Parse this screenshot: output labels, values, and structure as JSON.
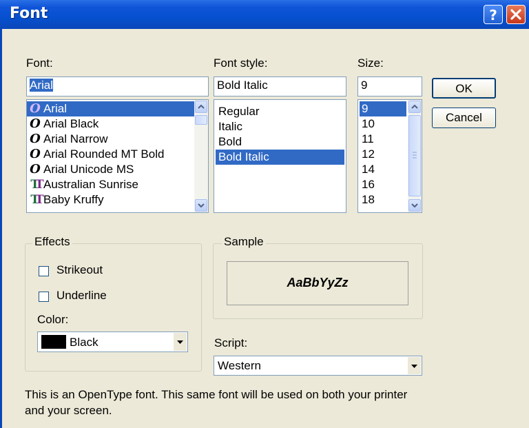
{
  "window": {
    "title": "Font"
  },
  "caption_buttons": {
    "help": "?",
    "close": "×"
  },
  "font": {
    "label": "Font:",
    "value": "Arial",
    "items": [
      {
        "label": "Arial",
        "icon": "opentype-icon",
        "selected": true
      },
      {
        "label": "Arial Black",
        "icon": "opentype-icon"
      },
      {
        "label": "Arial Narrow",
        "icon": "opentype-icon"
      },
      {
        "label": "Arial Rounded MT Bold",
        "icon": "opentype-icon"
      },
      {
        "label": "Arial Unicode MS",
        "icon": "opentype-icon"
      },
      {
        "label": "Australian Sunrise",
        "icon": "truetype-icon"
      },
      {
        "label": "Baby Kruffy",
        "icon": "truetype-icon"
      }
    ]
  },
  "style": {
    "label": "Font style:",
    "value": "Bold Italic",
    "items": [
      "Regular",
      "Italic",
      "Bold",
      "Bold Italic"
    ],
    "selected_index": 3
  },
  "size": {
    "label": "Size:",
    "value": "9",
    "items": [
      "9",
      "10",
      "11",
      "12",
      "14",
      "16",
      "18"
    ],
    "selected_index": 0
  },
  "buttons": {
    "ok": "OK",
    "cancel": "Cancel"
  },
  "effects": {
    "title": "Effects",
    "strikeout": "Strikeout",
    "underline": "Underline",
    "strikeout_checked": false,
    "underline_checked": false,
    "color_label": "Color:",
    "color_value": "Black",
    "color_swatch": "#000000"
  },
  "sample": {
    "title": "Sample",
    "text": "AaBbYyZz"
  },
  "script": {
    "label": "Script:",
    "value": "Western"
  },
  "info": "This is an OpenType font. This same font will be used on both your printer and your screen.",
  "colors": {
    "title_bar": "#0650d0",
    "selection": "#316ac5",
    "dialog_bg": "#ece9d8",
    "close_button": "#c8371b"
  }
}
